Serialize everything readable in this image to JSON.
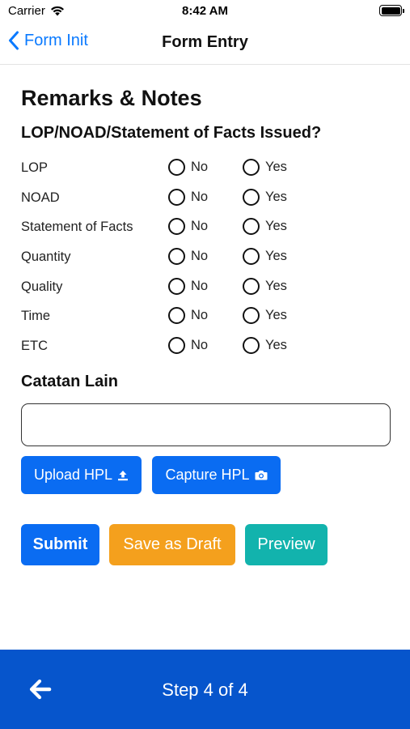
{
  "status_bar": {
    "carrier": "Carrier",
    "time": "8:42 AM"
  },
  "nav": {
    "back_label": "Form Init",
    "title": "Form Entry"
  },
  "section_title": "Remarks & Notes",
  "question": "LOP/NOAD/Statement of Facts Issued?",
  "options": {
    "no": "No",
    "yes": "Yes"
  },
  "rows": [
    {
      "label": "LOP"
    },
    {
      "label": "NOAD"
    },
    {
      "label": "Statement of Facts"
    },
    {
      "label": "Quantity"
    },
    {
      "label": "Quality"
    },
    {
      "label": "Time"
    },
    {
      "label": "ETC"
    }
  ],
  "notes": {
    "label": "Catatan Lain",
    "value": "",
    "placeholder": ""
  },
  "buttons": {
    "upload": "Upload HPL",
    "capture": "Capture HPL",
    "submit": "Submit",
    "draft": "Save as Draft",
    "preview": "Preview"
  },
  "footer": {
    "step": "Step 4 of 4"
  },
  "colors": {
    "primary": "#0a6cf2",
    "warning": "#f4a01d",
    "teal": "#12b3ad",
    "footer": "#0655cc",
    "link": "#0a7aff"
  }
}
